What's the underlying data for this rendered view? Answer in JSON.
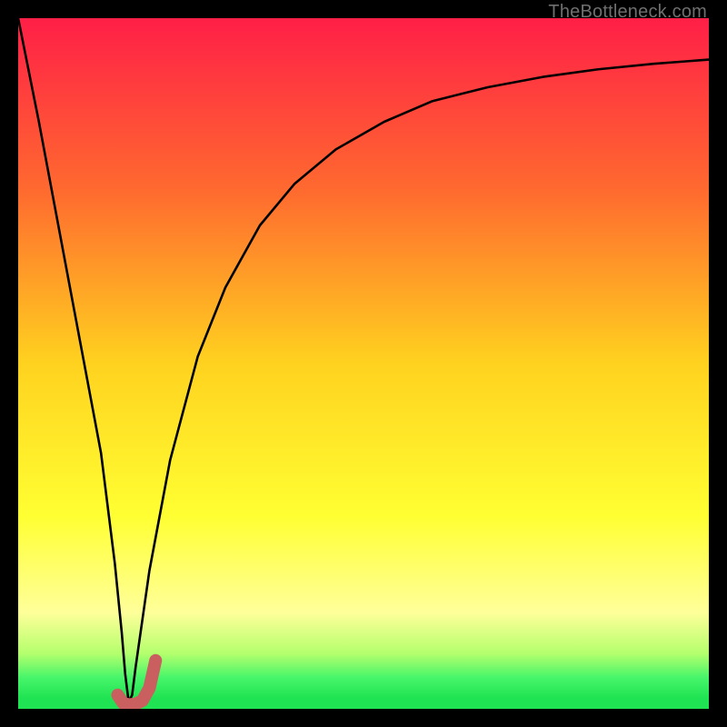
{
  "watermark": "TheBottleneck.com",
  "colors": {
    "frame": "#000000",
    "curve_stroke": "#000000",
    "marker_stroke": "#c95f5f",
    "green_band": "#1fe352",
    "gradient_stops": [
      {
        "offset": 0.0,
        "color": "#ff1f47"
      },
      {
        "offset": 0.25,
        "color": "#ff6a2f"
      },
      {
        "offset": 0.5,
        "color": "#ffd21f"
      },
      {
        "offset": 0.72,
        "color": "#ffff32"
      },
      {
        "offset": 0.86,
        "color": "#ffff9a"
      },
      {
        "offset": 0.92,
        "color": "#b4ff6d"
      },
      {
        "offset": 0.955,
        "color": "#47f56a"
      },
      {
        "offset": 0.985,
        "color": "#1fe352"
      },
      {
        "offset": 1.0,
        "color": "#1fe352"
      }
    ]
  },
  "chart_data": {
    "type": "line",
    "title": "",
    "xlabel": "",
    "ylabel": "",
    "xlim": [
      0,
      100
    ],
    "ylim": [
      0,
      100
    ],
    "series": [
      {
        "name": "bottleneck-curve",
        "x": [
          0,
          3,
          6,
          9,
          12,
          14,
          15,
          15.5,
          16,
          16.5,
          17,
          19,
          22,
          26,
          30,
          35,
          40,
          46,
          53,
          60,
          68,
          76,
          84,
          92,
          100
        ],
        "values": [
          100,
          85,
          69,
          53,
          37,
          21,
          11,
          5,
          1,
          2,
          6,
          20,
          36,
          51,
          61,
          70,
          76,
          81,
          85,
          88,
          90,
          91.5,
          92.6,
          93.4,
          94
        ]
      }
    ],
    "marker": {
      "name": "J-marker",
      "color": "#c95f5f",
      "x": [
        14.4,
        15.2,
        16.0,
        17.0,
        18.0,
        19.0,
        19.9
      ],
      "values": [
        2.0,
        0.8,
        0.6,
        0.7,
        1.2,
        3.0,
        7.0
      ]
    }
  }
}
